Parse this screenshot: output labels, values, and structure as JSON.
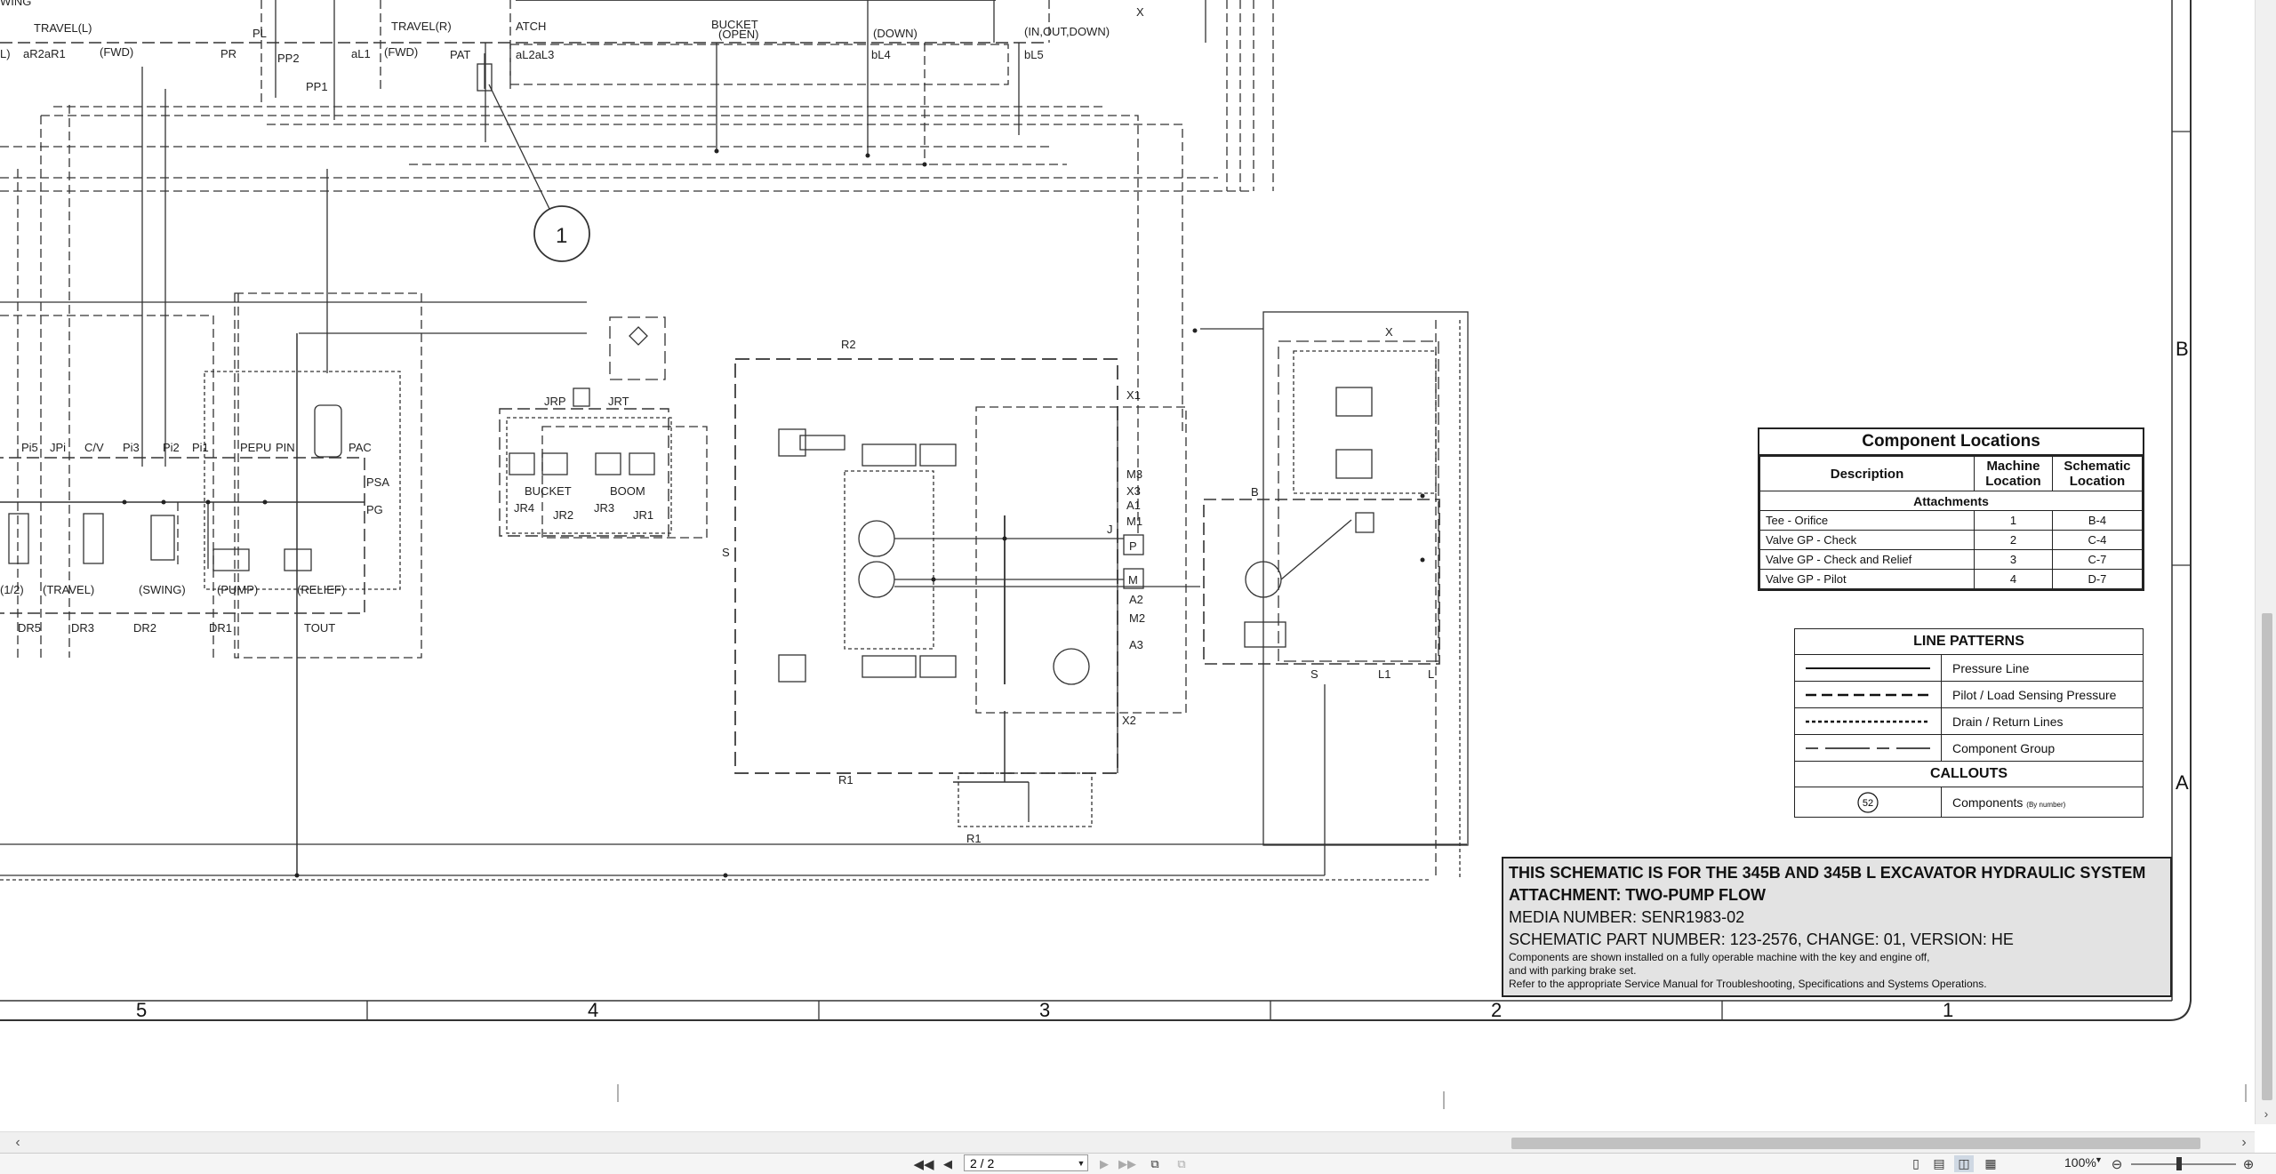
{
  "schematic": {
    "callout_number": "1",
    "labels": {
      "wing": "WING",
      "travel_l": "TRAVEL(L)",
      "pl": "PL",
      "travel_r": "TRAVEL(R)",
      "atch": "ATCH",
      "bucket": "BUCKET",
      "open": "(OPEN)",
      "down": "(DOWN)",
      "in_out_down": "(IN,OUT,DOWN)",
      "x_top": "X",
      "l_paren": "L)",
      "ar2ar1": "aR2aR1",
      "fwd1": "(FWD)",
      "pr": "PR",
      "pp2": "PP2",
      "al1": "aL1",
      "fwd2": "(FWD)",
      "pat": "PAT",
      "al2al3": "aL2aL3",
      "bl4": "bL4",
      "bl5": "bL5",
      "pp1": "PP1",
      "pi5": "Pi5",
      "jpi": "JPi",
      "cv": "C/V",
      "pi3": "Pi3",
      "pi2": "Pi2",
      "pi1": "Pi1",
      "pepu": "PEPU",
      "pin": "PIN",
      "pac": "PAC",
      "psa": "PSA",
      "pg": "PG",
      "half": "(1/2)",
      "travel": "(TRAVEL)",
      "swing": "(SWING)",
      "pump": "(PUMP)",
      "relief": "(RELIEF)",
      "dr5": "DR5",
      "dr3": "DR3",
      "dr2": "DR2",
      "dr1": "DR1",
      "tout": "TOUT",
      "jrp": "JRP",
      "jrt": "JRT",
      "bucket2": "BUCKET",
      "boom": "BOOM",
      "jr4": "JR4",
      "jr2": "JR2",
      "jr3": "JR3",
      "jr1": "JR1",
      "r2": "R2",
      "x1": "X1",
      "m3": "M3",
      "x3": "X3",
      "a1": "A1",
      "m1": "M1",
      "j": "J",
      "p": "P",
      "m": "M",
      "a2": "A2",
      "m2": "M2",
      "a3": "A3",
      "x2": "X2",
      "r1a": "R1",
      "r1b": "R1",
      "s1": "S",
      "b": "B",
      "x_right": "X",
      "s2": "S",
      "l1": "L1",
      "l": "L"
    }
  },
  "component_locations": {
    "title": "Component Locations",
    "headers": [
      "Description",
      "Machine Location",
      "Schematic Location"
    ],
    "group": "Attachments",
    "rows": [
      {
        "description": "Tee - Orifice",
        "machine": "1",
        "schematic": "B-4"
      },
      {
        "description": "Valve GP - Check",
        "machine": "2",
        "schematic": "C-4"
      },
      {
        "description": "Valve GP - Check and Relief",
        "machine": "3",
        "schematic": "C-7"
      },
      {
        "description": "Valve GP - Pilot",
        "machine": "4",
        "schematic": "D-7"
      }
    ]
  },
  "line_patterns": {
    "title": "LINE PATTERNS",
    "items": [
      {
        "name": "Pressure Line",
        "style": "solid"
      },
      {
        "name": "Pilot / Load Sensing Pressure",
        "style": "dashed"
      },
      {
        "name": "Drain / Return Lines",
        "style": "dotted"
      },
      {
        "name": "Component Group",
        "style": "dashdot"
      }
    ],
    "callouts_title": "CALLOUTS",
    "callout_sample": "52",
    "callout_label": "Components",
    "callout_note": "(By number)"
  },
  "title_block": {
    "line1": "THIS SCHEMATIC IS FOR THE 345B AND 345B L EXCAVATOR HYDRAULIC SYSTEM",
    "line2": "ATTACHMENT: TWO-PUMP FLOW",
    "media": "MEDIA NUMBER: SENR1983-02",
    "part": "SCHEMATIC PART NUMBER: 123-2576, CHANGE: 01, VERSION: HE",
    "note1": "Components are shown installed on a fully operable machine with the key and engine off,",
    "note2": "and with parking brake set.",
    "note3": "Refer to the appropriate Service Manual for Troubleshooting, Specifications and Systems Operations."
  },
  "grid": {
    "columns": [
      "5",
      "4",
      "3",
      "2",
      "1"
    ],
    "rows": [
      "B",
      "A"
    ]
  },
  "viewer": {
    "page_value": "2 / 2",
    "zoom": "100%",
    "icons": {
      "first": "first-page-icon",
      "prev": "previous-page-icon",
      "next": "next-page-icon",
      "last": "last-page-icon",
      "prev_view": "previous-view-icon",
      "next_view": "next-view-icon",
      "single": "single-page-icon",
      "continuous": "continuous-icon",
      "facing": "facing-icon",
      "cont_facing": "continuous-facing-icon",
      "zoom_out": "zoom-out-icon",
      "zoom_in": "zoom-in-icon"
    }
  }
}
